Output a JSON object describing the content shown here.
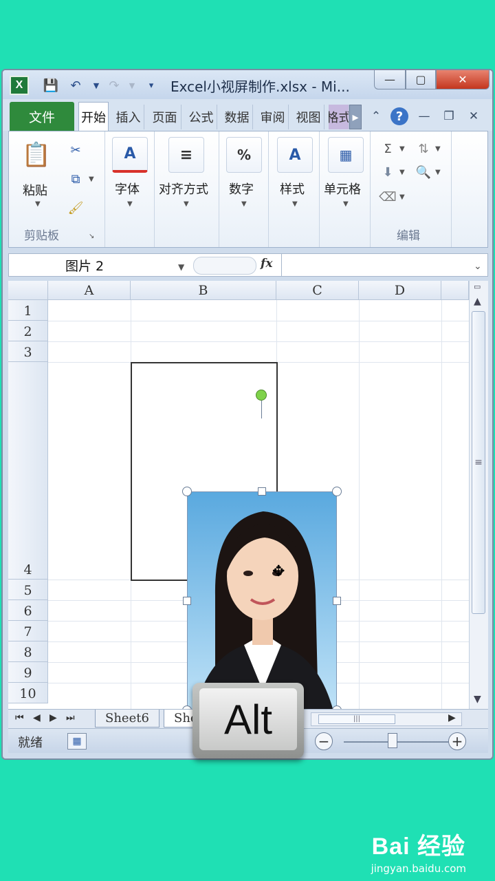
{
  "window": {
    "title": "Excel小视屏制作.xlsx  -  Mi...",
    "app_icon": "X",
    "controls": {
      "minimize": "—",
      "restore": "▢",
      "close": "✕"
    }
  },
  "tabs": {
    "file": "文件",
    "items": [
      "开始",
      "插入",
      "页面",
      "公式",
      "数据",
      "审阅",
      "视图",
      "格式"
    ],
    "scroll": "▸"
  },
  "ribbon": {
    "paste": "粘贴",
    "clipboard_group": "剪贴板",
    "font": "字体",
    "alignment": "对齐方式",
    "number": "数字",
    "styles": "样式",
    "cells": "单元格",
    "editing_group": "编辑"
  },
  "formula": {
    "name_box": "图片  2",
    "fx": "fx"
  },
  "grid": {
    "columns": [
      "A",
      "B",
      "C",
      "D"
    ],
    "rows": [
      "1",
      "2",
      "3",
      "4",
      "5",
      "6",
      "7",
      "8",
      "9",
      "10"
    ]
  },
  "sheets": {
    "tab1": "Sheet6",
    "tab2": "She"
  },
  "status": {
    "ready": "就绪"
  },
  "key_overlay": "Alt",
  "watermark": {
    "logo": "Bai 经验",
    "url": "jingyan.baidu.com"
  },
  "colors": {
    "background": "#1fe0b4",
    "file_tab": "#2f8a3c",
    "close_button": "#c4361e"
  }
}
